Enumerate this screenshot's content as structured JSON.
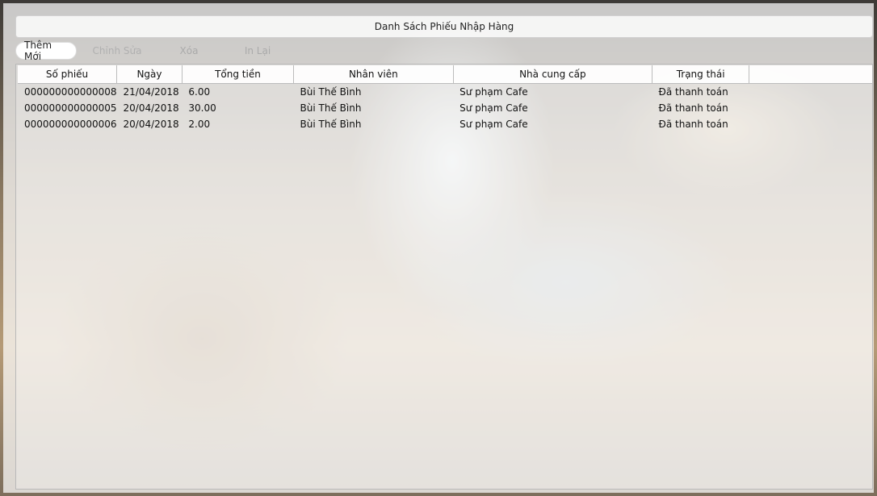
{
  "window": {
    "title": "Danh Sách Phiếu Nhập Hàng"
  },
  "toolbar": {
    "add_label": "Thêm Mới",
    "edit_label": "Chỉnh Sửa",
    "delete_label": "Xóa",
    "print_label": "In Lại"
  },
  "table": {
    "columns": [
      "Số phiếu",
      "Ngày",
      "Tổng tiền",
      "Nhân viên",
      "Nhà cung cấp",
      "Trạng thái",
      ""
    ],
    "rows": [
      [
        "000000000000008",
        "21/04/2018",
        "6.00",
        "Bùi Thế Bình",
        "Sư phạm Cafe",
        "Đã thanh toán"
      ],
      [
        "000000000000005",
        "20/04/2018",
        "30.00",
        "Bùi Thế Bình",
        "Sư phạm Cafe",
        "Đã thanh toán"
      ],
      [
        "000000000000006",
        "20/04/2018",
        "2.00",
        "Bùi Thế Bình",
        "Sư phạm Cafe",
        "Đã thanh toán"
      ]
    ]
  }
}
